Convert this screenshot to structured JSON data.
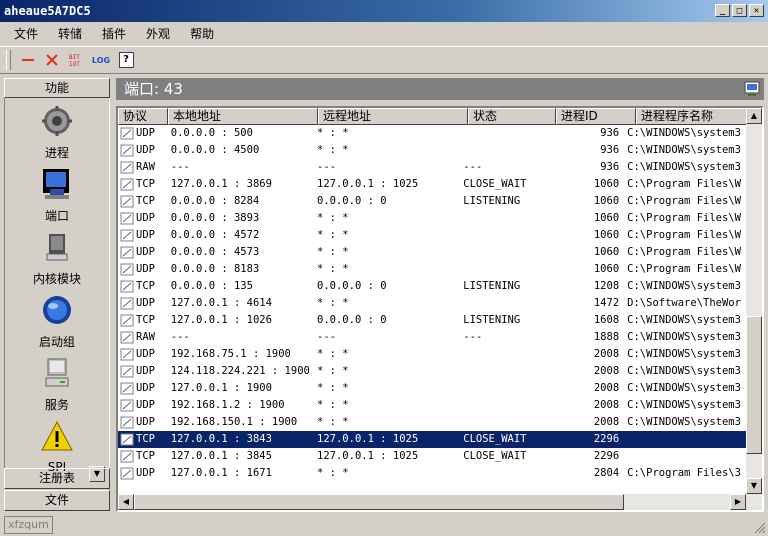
{
  "window": {
    "title": "aheaue5A7DC5",
    "min": "_",
    "max": "□",
    "close": "✕"
  },
  "menu": [
    "文件",
    "转储",
    "插件",
    "外观",
    "帮助"
  ],
  "toolbar": {
    "bin_label": "BIT\nIOT",
    "log_label": "LOG",
    "help_label": "?"
  },
  "sidebar": {
    "header": "功能",
    "items": [
      {
        "label": "进程",
        "icon": "gear-icon"
      },
      {
        "label": "端口",
        "icon": "network-computer-icon"
      },
      {
        "label": "内核模块",
        "icon": "disk-icon"
      },
      {
        "label": "启动组",
        "icon": "globe-icon"
      },
      {
        "label": "服务",
        "icon": "computer-icon"
      },
      {
        "label": "SPI",
        "icon": "warning-icon"
      }
    ],
    "footer": [
      "注册表",
      "文件"
    ]
  },
  "port_panel": {
    "title": "端口: 43"
  },
  "columns": [
    "协议",
    "本地地址",
    "远程地址",
    "状态",
    "进程ID",
    "进程程序名称"
  ],
  "rows": [
    [
      "UDP",
      "0.0.0.0 : 500",
      "* : *",
      "",
      "936",
      "C:\\WINDOWS\\system3"
    ],
    [
      "UDP",
      "0.0.0.0 : 4500",
      "* : *",
      "",
      "936",
      "C:\\WINDOWS\\system3"
    ],
    [
      "RAW",
      "---",
      "---",
      "---",
      "936",
      "C:\\WINDOWS\\system3"
    ],
    [
      "TCP",
      "127.0.0.1 : 3869",
      "127.0.0.1 : 1025",
      "CLOSE_WAIT",
      "1060",
      "C:\\Program Files\\W"
    ],
    [
      "TCP",
      "0.0.0.0 : 8284",
      "0.0.0.0 : 0",
      "LISTENING",
      "1060",
      "C:\\Program Files\\W"
    ],
    [
      "UDP",
      "0.0.0.0 : 3893",
      "* : *",
      "",
      "1060",
      "C:\\Program Files\\W"
    ],
    [
      "UDP",
      "0.0.0.0 : 4572",
      "* : *",
      "",
      "1060",
      "C:\\Program Files\\W"
    ],
    [
      "UDP",
      "0.0.0.0 : 4573",
      "* : *",
      "",
      "1060",
      "C:\\Program Files\\W"
    ],
    [
      "UDP",
      "0.0.0.0 : 8183",
      "* : *",
      "",
      "1060",
      "C:\\Program Files\\W"
    ],
    [
      "TCP",
      "0.0.0.0 : 135",
      "0.0.0.0 : 0",
      "LISTENING",
      "1208",
      "C:\\WINDOWS\\system3"
    ],
    [
      "UDP",
      "127.0.0.1 : 4614",
      "* : *",
      "",
      "1472",
      "D:\\Software\\TheWor"
    ],
    [
      "TCP",
      "127.0.0.1 : 1026",
      "0.0.0.0 : 0",
      "LISTENING",
      "1608",
      "C:\\WINDOWS\\system3"
    ],
    [
      "RAW",
      "---",
      "---",
      "---",
      "1888",
      "C:\\WINDOWS\\system3"
    ],
    [
      "UDP",
      "192.168.75.1 : 1900",
      "* : *",
      "",
      "2008",
      "C:\\WINDOWS\\system3"
    ],
    [
      "UDP",
      "124.118.224.221 : 1900",
      "* : *",
      "",
      "2008",
      "C:\\WINDOWS\\system3"
    ],
    [
      "UDP",
      "127.0.0.1 : 1900",
      "* : *",
      "",
      "2008",
      "C:\\WINDOWS\\system3"
    ],
    [
      "UDP",
      "192.168.1.2 : 1900",
      "* : *",
      "",
      "2008",
      "C:\\WINDOWS\\system3"
    ],
    [
      "UDP",
      "192.168.150.1 : 1900",
      "* : *",
      "",
      "2008",
      "C:\\WINDOWS\\system3"
    ],
    [
      "TCP",
      "127.0.0.1 : 3843",
      "127.0.0.1 : 1025",
      "CLOSE_WAIT",
      "2296",
      ""
    ],
    [
      "TCP",
      "127.0.0.1 : 3845",
      "127.0.0.1 : 1025",
      "CLOSE_WAIT",
      "2296",
      ""
    ],
    [
      "UDP",
      "127.0.0.1 : 1671",
      "* : *",
      "",
      "2804",
      "C:\\Program Files\\3"
    ]
  ],
  "selected_row": 18,
  "statusbar": {
    "text": "xfzqum"
  }
}
